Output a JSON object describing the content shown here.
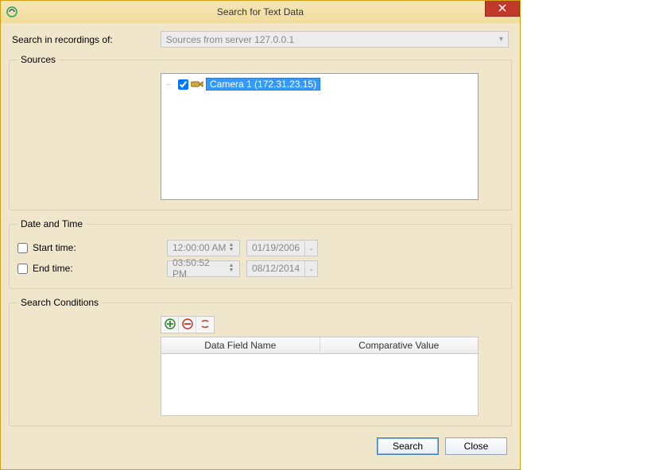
{
  "window": {
    "title": "Search for Text Data"
  },
  "top": {
    "label": "Search in recordings of:",
    "server_combo": "Sources from server 127.0.0.1"
  },
  "sources": {
    "legend": "Sources",
    "items": [
      {
        "checked": true,
        "label": "Camera 1 (172.31.23.15)"
      }
    ]
  },
  "datetime": {
    "legend": "Date and Time",
    "start_label": "Start time:",
    "start_checked": false,
    "start_time": "12:00:00 AM",
    "start_date": "01/19/2006",
    "end_label": "End time:",
    "end_checked": false,
    "end_time": "03:50:52 PM",
    "end_date": "08/12/2014"
  },
  "conditions": {
    "legend": "Search Conditions",
    "columns": {
      "field": "Data Field Name",
      "value": "Comparative Value"
    }
  },
  "footer": {
    "search": "Search",
    "close": "Close"
  }
}
